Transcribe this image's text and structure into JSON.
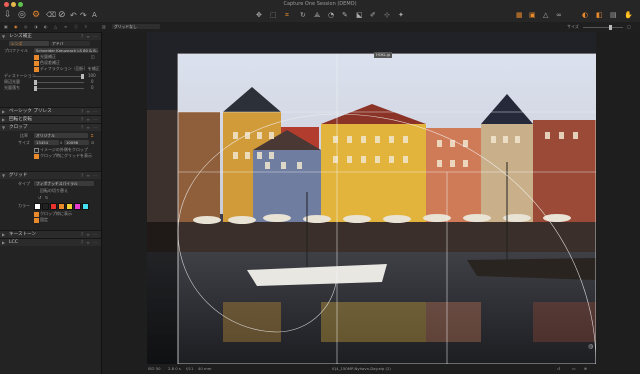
{
  "app": {
    "window_title": "Capture One Session (DEMO)",
    "lock_badge": "DEMO"
  },
  "viewer_strip": {
    "grid_select": "グリッドなし",
    "size_label": "サイズ",
    "overlay_badge": "HOKL.jp"
  },
  "left_panel": {
    "lens_section": {
      "title": "レンズ補正",
      "tab_lens": "レンズ",
      "tab_manual": "アドバ",
      "profile_label": "プロファイル",
      "profile_value": "Schneider Kreuznach LS 80 & 8…",
      "opt_light_falloff": "光量補正",
      "opt_chromatic": "色収差補正",
      "opt_diffraction": "ディフラクション（回折）を補正",
      "distortion_label": "ディストーション",
      "distortion_value": "100",
      "sharpness_label": "周辺光量",
      "sharpness_value": "0",
      "light_label": "光量落ち",
      "light_value": "0"
    },
    "base_section": {
      "title": "ベーシック プリレス"
    },
    "rotation_section": {
      "title": "回転と反転"
    },
    "crop_section": {
      "title": "クロップ",
      "ratio_label": "比率",
      "ratio_value": "オリジナル",
      "size_label": "サイズ",
      "width_value": "13454",
      "height_value": "10096",
      "opt_outside": "イメージの外側をクロップ",
      "opt_grid": "クロップ時にグリッドを表示"
    },
    "grid_section": {
      "title": "グリッド",
      "type_label": "タイプ",
      "type_value": "フィボナッチスパイラル",
      "rotate_label": "回転の切り替え",
      "color_label": "カラー",
      "color_swatches": [
        "#ffffff",
        "#222222",
        "#e8322b",
        "#e8892c",
        "#f1d033",
        "#e83bd2",
        "#44e0f2"
      ],
      "opt_crop_outline": "クロップ枠に表示",
      "opt_fixed": "固定"
    },
    "keystone_section": {
      "title": "キーストーン"
    },
    "lcc_section": {
      "title": "LCC"
    }
  },
  "status_bar": {
    "iso": "ISO 50",
    "shutter": "2.8 0 s",
    "aperture": "f/11",
    "focal": "40 mm",
    "filename": "IQ4_150MP-Nyhavn-Day.eip (2)"
  }
}
